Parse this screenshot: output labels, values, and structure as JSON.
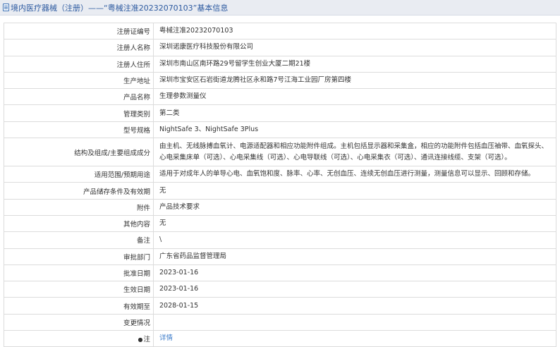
{
  "header": {
    "breadcrumb": "境内医疗器械（注册）——“粤械注准20232070103”基本信息",
    "icon": "document-icon"
  },
  "rows": [
    {
      "label": "注册证编号",
      "value": "粤械注准20232070103"
    },
    {
      "label": "注册人名称",
      "value": "深圳诺康医疗科技股份有限公司"
    },
    {
      "label": "注册人住所",
      "value": "深圳市南山区南环路29号留学生创业大厦二期21楼"
    },
    {
      "label": "生产地址",
      "value": "深圳市宝安区石岩街道龙腾社区永和路7号江海工业园厂房第四楼"
    },
    {
      "label": "产品名称",
      "value": "生理参数测量仪"
    },
    {
      "label": "管理类别",
      "value": "第二类"
    },
    {
      "label": "型号规格",
      "value": "NightSafe 3、NightSafe 3Plus"
    },
    {
      "label": "结构及组成/主要组成成分",
      "value": "由主机、无线脉搏血氧计、电源适配器和相应功能附件组成。主机包括显示器和采集盒，相应的功能附件包括血压袖带、血氧探头、心电采集床单（可选）、心电采集线（可选）、心电导联线（可选）、心电采集衣（可选）、通讯连接线缆、支架（可选）。"
    },
    {
      "label": "适用范围/预期用途",
      "value": "适用于对成年人的单导心电、血氧饱和度、脉率、心率、无创血压、连续无创血压进行测量，测量信息可以显示、回顾和存储。"
    },
    {
      "label": "产品储存条件及有效期",
      "value": "无"
    },
    {
      "label": "附件",
      "value": "产品技术要求"
    },
    {
      "label": "其他内容",
      "value": "无"
    },
    {
      "label": "备注",
      "value": "\\"
    },
    {
      "label": "审批部门",
      "value": "广东省药品监督管理局"
    },
    {
      "label": "批准日期",
      "value": "2023-01-16"
    },
    {
      "label": "生效日期",
      "value": "2023-01-16"
    },
    {
      "label": "有效期至",
      "value": "2028-01-15"
    },
    {
      "label": "变更情况",
      "value": ""
    },
    {
      "label": "注",
      "value": "详情"
    }
  ]
}
